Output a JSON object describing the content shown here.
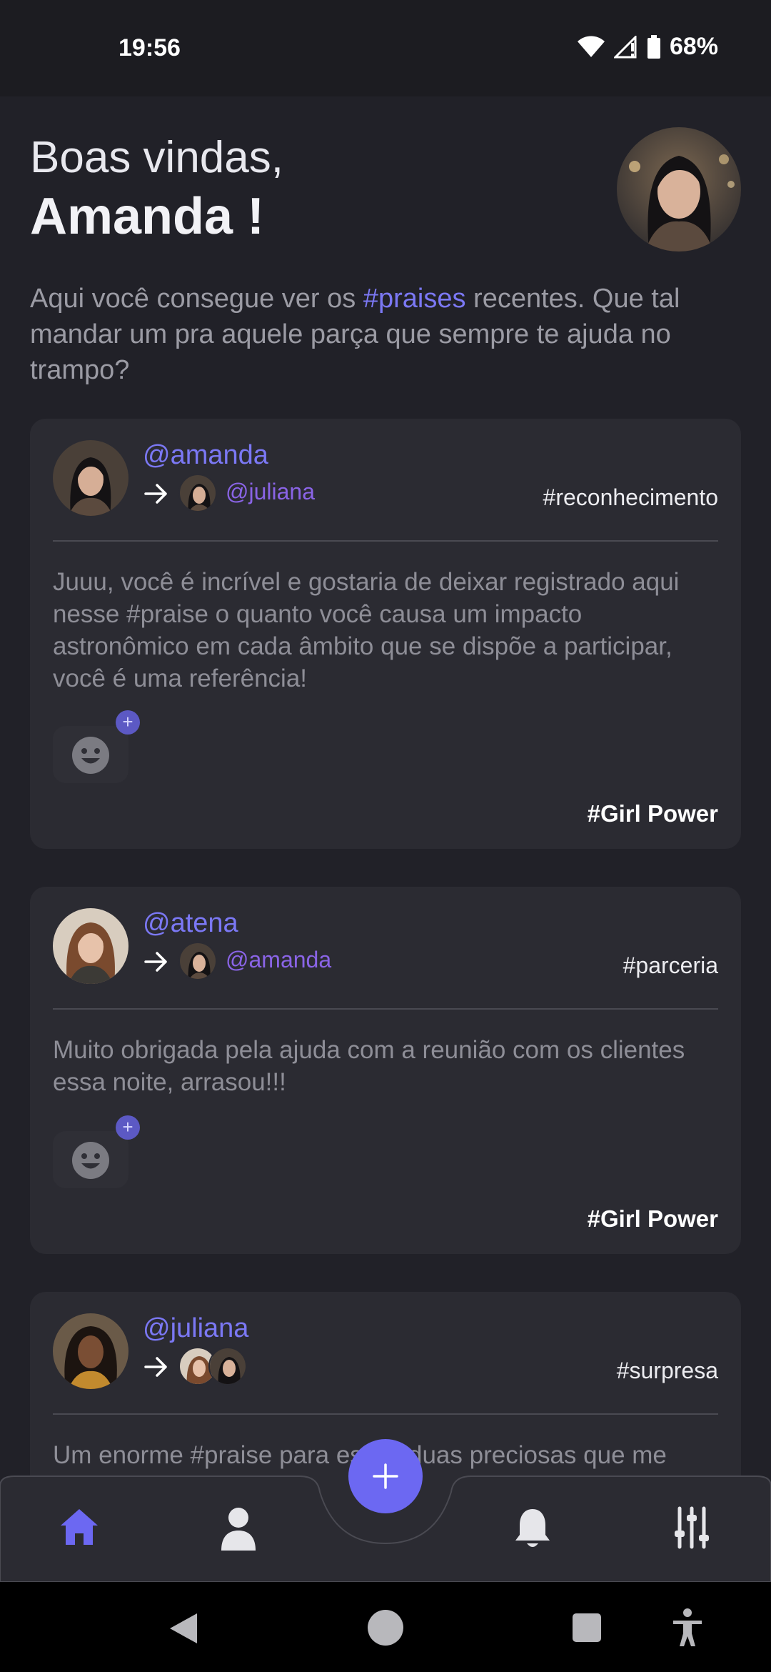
{
  "status_bar": {
    "time": "19:56",
    "battery": "68%"
  },
  "header": {
    "greeting": "Boas vindas,",
    "user_name": "Amanda !"
  },
  "intro": {
    "before": "Aqui você consegue ver os ",
    "tag": "#praises",
    "after": " recentes. Que tal mandar um pra aquele parça que sempre te ajuda no trampo?"
  },
  "posts": [
    {
      "author": "@amanda",
      "recipient": "@juliana",
      "category": "#reconhecimento",
      "message": "Juuu, você é incrível e gostaria de deixar registrado aqui nesse #praise o quanto você causa um impacto astronômico em cada âmbito que se dispõe a participar, você é uma referência!",
      "tag": "#Girl Power"
    },
    {
      "author": "@atena",
      "recipient": "@amanda",
      "category": "#parceria",
      "message": "Muito obrigada pela ajuda com a reunião com os clientes essa noite, arrasou!!!",
      "tag": "#Girl Power"
    },
    {
      "author": "@juliana",
      "recipient": "",
      "category": "#surpresa",
      "message": "Um enorme #praise para essas duas preciosas que me"
    }
  ],
  "reaction_add": "+",
  "nav": {
    "items": [
      "home-icon",
      "profile-icon",
      "bell-icon",
      "settings-sliders-icon"
    ],
    "fab": "plus-icon"
  },
  "colors": {
    "accent": "#7b78f4",
    "background": "#212128",
    "card": "#2b2b32"
  }
}
